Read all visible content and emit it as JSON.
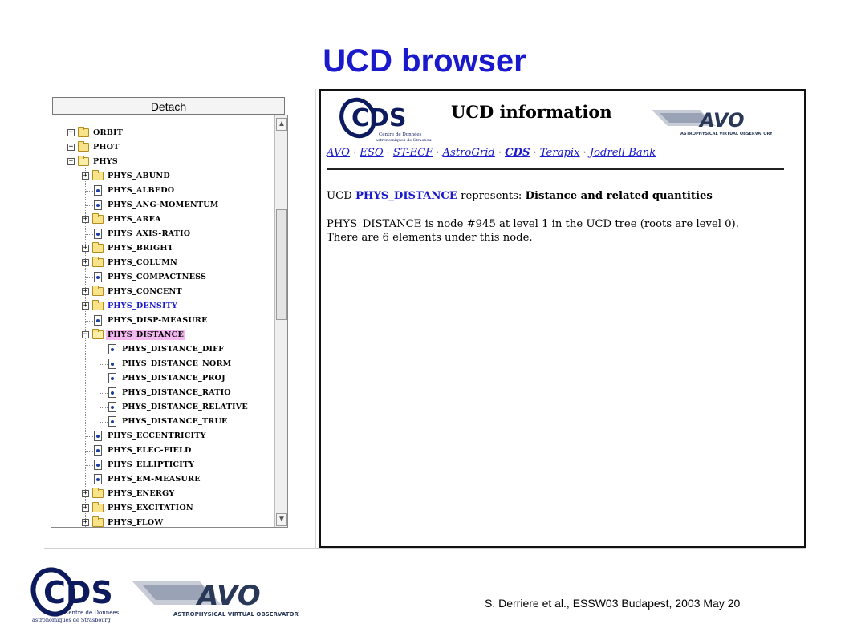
{
  "slide": {
    "title": "UCD browser",
    "footer": "S. Derriere et al., ESSW03 Budapest, 2003 May 20"
  },
  "logos": {
    "cds": {
      "letters": "CDS",
      "line1": "Centre de Données",
      "line2": "astronomiques de Strasbourg"
    },
    "avo": {
      "letters": "AVO",
      "line1": "ASTROPHYSICAL VIRTUAL OBSERVATORY"
    }
  },
  "tree": {
    "detach_label": "Detach",
    "rows": [
      {
        "label": "ORBIT",
        "depth": 0,
        "type": "folder",
        "expand": "+"
      },
      {
        "label": "PHOT",
        "depth": 0,
        "type": "folder",
        "expand": "+"
      },
      {
        "label": "PHYS",
        "depth": 0,
        "type": "folder-open",
        "expand": "-"
      },
      {
        "label": "PHYS_ABUND",
        "depth": 1,
        "type": "folder",
        "expand": "+"
      },
      {
        "label": "PHYS_ALBEDO",
        "depth": 1,
        "type": "doc"
      },
      {
        "label": "PHYS_ANG-MOMENTUM",
        "depth": 1,
        "type": "doc"
      },
      {
        "label": "PHYS_AREA",
        "depth": 1,
        "type": "folder",
        "expand": "+"
      },
      {
        "label": "PHYS_AXIS-RATIO",
        "depth": 1,
        "type": "doc"
      },
      {
        "label": "PHYS_BRIGHT",
        "depth": 1,
        "type": "folder",
        "expand": "+"
      },
      {
        "label": "PHYS_COLUMN",
        "depth": 1,
        "type": "folder",
        "expand": "+"
      },
      {
        "label": "PHYS_COMPACTNESS",
        "depth": 1,
        "type": "doc"
      },
      {
        "label": "PHYS_CONCENT",
        "depth": 1,
        "type": "folder",
        "expand": "+"
      },
      {
        "label": "PHYS_DENSITY",
        "depth": 1,
        "type": "folder",
        "expand": "+",
        "style": "blue"
      },
      {
        "label": "PHYS_DISP-MEASURE",
        "depth": 1,
        "type": "doc"
      },
      {
        "label": "PHYS_DISTANCE",
        "depth": 1,
        "type": "folder-open",
        "expand": "-",
        "style": "highlight"
      },
      {
        "label": "PHYS_DISTANCE_DIFF",
        "depth": 2,
        "type": "doc"
      },
      {
        "label": "PHYS_DISTANCE_NORM",
        "depth": 2,
        "type": "doc"
      },
      {
        "label": "PHYS_DISTANCE_PROJ",
        "depth": 2,
        "type": "doc"
      },
      {
        "label": "PHYS_DISTANCE_RATIO",
        "depth": 2,
        "type": "doc"
      },
      {
        "label": "PHYS_DISTANCE_RELATIVE",
        "depth": 2,
        "type": "doc"
      },
      {
        "label": "PHYS_DISTANCE_TRUE",
        "depth": 2,
        "type": "doc"
      },
      {
        "label": "PHYS_ECCENTRICITY",
        "depth": 1,
        "type": "doc"
      },
      {
        "label": "PHYS_ELEC-FIELD",
        "depth": 1,
        "type": "doc"
      },
      {
        "label": "PHYS_ELLIPTICITY",
        "depth": 1,
        "type": "doc"
      },
      {
        "label": "PHYS_EM-MEASURE",
        "depth": 1,
        "type": "doc"
      },
      {
        "label": "PHYS_ENERGY",
        "depth": 1,
        "type": "folder",
        "expand": "+"
      },
      {
        "label": "PHYS_EXCITATION",
        "depth": 1,
        "type": "folder",
        "expand": "+"
      },
      {
        "label": "PHYS_FLOW",
        "depth": 1,
        "type": "folder",
        "expand": "+"
      }
    ]
  },
  "info": {
    "title": "UCD information",
    "links": [
      "AVO",
      "ESO",
      "ST-ECF",
      "AstroGrid",
      "CDS",
      "Terapix",
      "Jodrell Bank"
    ],
    "separator": "·",
    "line1_prefix": "UCD ",
    "line1_ucd": "PHYS_DISTANCE",
    "line1_mid": " represents: ",
    "line1_desc": "Distance and related quantities",
    "line2": "PHYS_DISTANCE is node #945 at level 1 in the UCD tree (roots are level 0).",
    "line3": "There are 6 elements under this node."
  },
  "colors": {
    "title_blue": "#1a1acc",
    "link_blue": "#1a1acc",
    "highlight_pink": "#f4b7f0"
  }
}
